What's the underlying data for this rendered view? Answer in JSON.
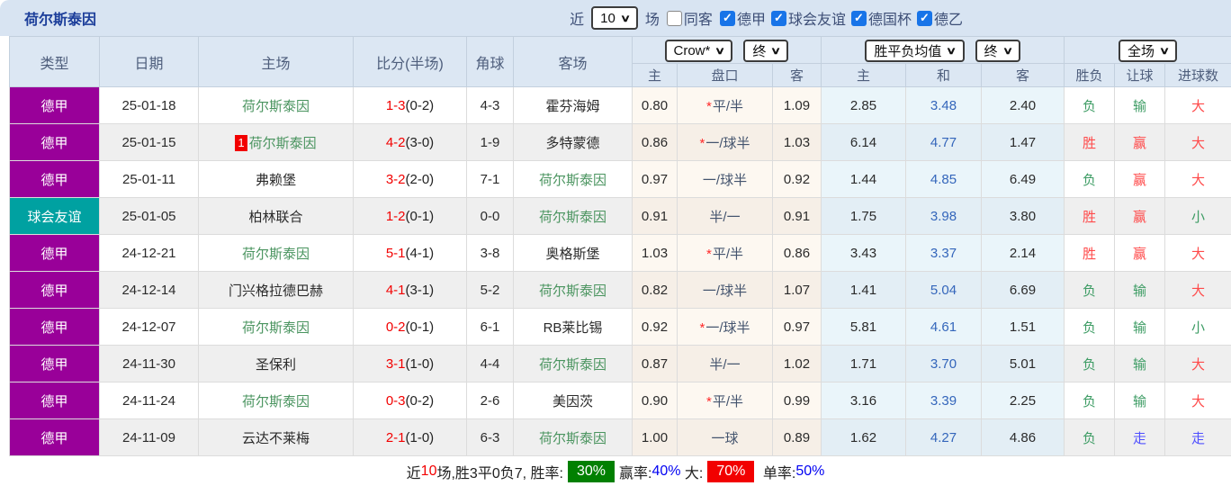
{
  "topbar": {
    "title": "荷尔斯泰因",
    "recent_label": "近",
    "recent_value": "10",
    "games_label": "场",
    "same_venue": {
      "label": "同客",
      "checked": false
    },
    "filters": [
      {
        "label": "德甲",
        "checked": true
      },
      {
        "label": "球会友谊",
        "checked": true
      },
      {
        "label": "德国杯",
        "checked": true
      },
      {
        "label": "德乙",
        "checked": true
      }
    ]
  },
  "table": {
    "main_headers": [
      "类型",
      "日期",
      "主场",
      "比分(半场)",
      "角球",
      "客场"
    ],
    "odds_group": {
      "select1": "Crow*",
      "select2": "终",
      "sub": [
        "主",
        "盘口",
        "客"
      ]
    },
    "avg_group": {
      "select1": "胜平负均值",
      "select2": "终",
      "sub": [
        "主",
        "和",
        "客"
      ]
    },
    "result_group": {
      "select": "全场",
      "sub": [
        "胜负",
        "让球",
        "进球数"
      ]
    },
    "star_symbol": "*",
    "rows": [
      {
        "type": "德甲",
        "type_color": "purple",
        "date": "25-01-18",
        "home": "荷尔斯泰因",
        "home_green": true,
        "home_badge": "",
        "score": "1-3",
        "half": "(0-2)",
        "corners": "4-3",
        "away": "霍芬海姆",
        "away_green": false,
        "odds_home": "0.80",
        "handicap": "平/半",
        "handicap_star": true,
        "odds_away": "1.09",
        "avg_home": "2.85",
        "avg_draw": "3.48",
        "avg_away": "2.40",
        "result": "负",
        "result_color": "green",
        "handicap_result": "输",
        "handicap_result_color": "green",
        "goals": "大",
        "goals_color": "red"
      },
      {
        "type": "德甲",
        "type_color": "purple",
        "date": "25-01-15",
        "home": "荷尔斯泰因",
        "home_green": true,
        "home_badge": "1",
        "score": "4-2",
        "half": "(3-0)",
        "corners": "1-9",
        "away": "多特蒙德",
        "away_green": false,
        "odds_home": "0.86",
        "handicap": "一/球半",
        "handicap_star": true,
        "odds_away": "1.03",
        "avg_home": "6.14",
        "avg_draw": "4.77",
        "avg_away": "1.47",
        "result": "胜",
        "result_color": "red",
        "handicap_result": "赢",
        "handicap_result_color": "red",
        "goals": "大",
        "goals_color": "red"
      },
      {
        "type": "德甲",
        "type_color": "purple",
        "date": "25-01-11",
        "home": "弗赖堡",
        "home_green": false,
        "home_badge": "",
        "score": "3-2",
        "half": "(2-0)",
        "corners": "7-1",
        "away": "荷尔斯泰因",
        "away_green": true,
        "odds_home": "0.97",
        "handicap": "一/球半",
        "handicap_star": false,
        "odds_away": "0.92",
        "avg_home": "1.44",
        "avg_draw": "4.85",
        "avg_away": "6.49",
        "result": "负",
        "result_color": "green",
        "handicap_result": "赢",
        "handicap_result_color": "red",
        "goals": "大",
        "goals_color": "red"
      },
      {
        "type": "球会友谊",
        "type_color": "teal",
        "date": "25-01-05",
        "home": "柏林联合",
        "home_green": false,
        "home_badge": "",
        "score": "1-2",
        "half": "(0-1)",
        "corners": "0-0",
        "away": "荷尔斯泰因",
        "away_green": true,
        "odds_home": "0.91",
        "handicap": "半/一",
        "handicap_star": false,
        "odds_away": "0.91",
        "avg_home": "1.75",
        "avg_draw": "3.98",
        "avg_away": "3.80",
        "result": "胜",
        "result_color": "red",
        "handicap_result": "赢",
        "handicap_result_color": "red",
        "goals": "小",
        "goals_color": "green"
      },
      {
        "type": "德甲",
        "type_color": "purple",
        "date": "24-12-21",
        "home": "荷尔斯泰因",
        "home_green": true,
        "home_badge": "",
        "score": "5-1",
        "half": "(4-1)",
        "corners": "3-8",
        "away": "奥格斯堡",
        "away_green": false,
        "odds_home": "1.03",
        "handicap": "平/半",
        "handicap_star": true,
        "odds_away": "0.86",
        "avg_home": "3.43",
        "avg_draw": "3.37",
        "avg_away": "2.14",
        "result": "胜",
        "result_color": "red",
        "handicap_result": "赢",
        "handicap_result_color": "red",
        "goals": "大",
        "goals_color": "red"
      },
      {
        "type": "德甲",
        "type_color": "purple",
        "date": "24-12-14",
        "home": "门兴格拉德巴赫",
        "home_green": false,
        "home_badge": "",
        "score": "4-1",
        "half": "(3-1)",
        "corners": "5-2",
        "away": "荷尔斯泰因",
        "away_green": true,
        "odds_home": "0.82",
        "handicap": "一/球半",
        "handicap_star": false,
        "odds_away": "1.07",
        "avg_home": "1.41",
        "avg_draw": "5.04",
        "avg_away": "6.69",
        "result": "负",
        "result_color": "green",
        "handicap_result": "输",
        "handicap_result_color": "green",
        "goals": "大",
        "goals_color": "red"
      },
      {
        "type": "德甲",
        "type_color": "purple",
        "date": "24-12-07",
        "home": "荷尔斯泰因",
        "home_green": true,
        "home_badge": "",
        "score": "0-2",
        "half": "(0-1)",
        "corners": "6-1",
        "away": "RB莱比锡",
        "away_green": false,
        "odds_home": "0.92",
        "handicap": "一/球半",
        "handicap_star": true,
        "odds_away": "0.97",
        "avg_home": "5.81",
        "avg_draw": "4.61",
        "avg_away": "1.51",
        "result": "负",
        "result_color": "green",
        "handicap_result": "输",
        "handicap_result_color": "green",
        "goals": "小",
        "goals_color": "green"
      },
      {
        "type": "德甲",
        "type_color": "purple",
        "date": "24-11-30",
        "home": "圣保利",
        "home_green": false,
        "home_badge": "",
        "score": "3-1",
        "half": "(1-0)",
        "corners": "4-4",
        "away": "荷尔斯泰因",
        "away_green": true,
        "odds_home": "0.87",
        "handicap": "半/一",
        "handicap_star": false,
        "odds_away": "1.02",
        "avg_home": "1.71",
        "avg_draw": "3.70",
        "avg_away": "5.01",
        "result": "负",
        "result_color": "green",
        "handicap_result": "输",
        "handicap_result_color": "green",
        "goals": "大",
        "goals_color": "red"
      },
      {
        "type": "德甲",
        "type_color": "purple",
        "date": "24-11-24",
        "home": "荷尔斯泰因",
        "home_green": true,
        "home_badge": "",
        "score": "0-3",
        "half": "(0-2)",
        "corners": "2-6",
        "away": "美因茨",
        "away_green": false,
        "odds_home": "0.90",
        "handicap": "平/半",
        "handicap_star": true,
        "odds_away": "0.99",
        "avg_home": "3.16",
        "avg_draw": "3.39",
        "avg_away": "2.25",
        "result": "负",
        "result_color": "green",
        "handicap_result": "输",
        "handicap_result_color": "green",
        "goals": "大",
        "goals_color": "red"
      },
      {
        "type": "德甲",
        "type_color": "purple",
        "date": "24-11-09",
        "home": "云达不莱梅",
        "home_green": false,
        "home_badge": "",
        "score": "2-1",
        "half": "(1-0)",
        "corners": "6-3",
        "away": "荷尔斯泰因",
        "away_green": true,
        "odds_home": "1.00",
        "handicap": "一球",
        "handicap_star": false,
        "odds_away": "0.89",
        "avg_home": "1.62",
        "avg_draw": "4.27",
        "avg_away": "4.86",
        "result": "负",
        "result_color": "green",
        "handicap_result": "走",
        "handicap_result_color": "blue",
        "goals": "走",
        "goals_color": "blue"
      }
    ]
  },
  "summary": {
    "part1": "近",
    "games": "10",
    "part2": "场,胜3平0负7, 胜率:",
    "win_rate": "30%",
    "part3": "赢率:",
    "handicap_rate": "40%",
    "part4": " 大:",
    "big_rate": "70%",
    "part5": " 单率:",
    "single_rate": "50%"
  },
  "colors": {
    "league_purple": "#990099",
    "league_teal": "#00a1a1",
    "win_red": "#ff4a4a",
    "lose_green": "#3d9c64",
    "draw_blue": "#5050ff",
    "team_green": "#4a945f",
    "score_red": "#f20000",
    "avg_draw_blue": "#3466bb",
    "handicap_slate": "#44546e"
  }
}
